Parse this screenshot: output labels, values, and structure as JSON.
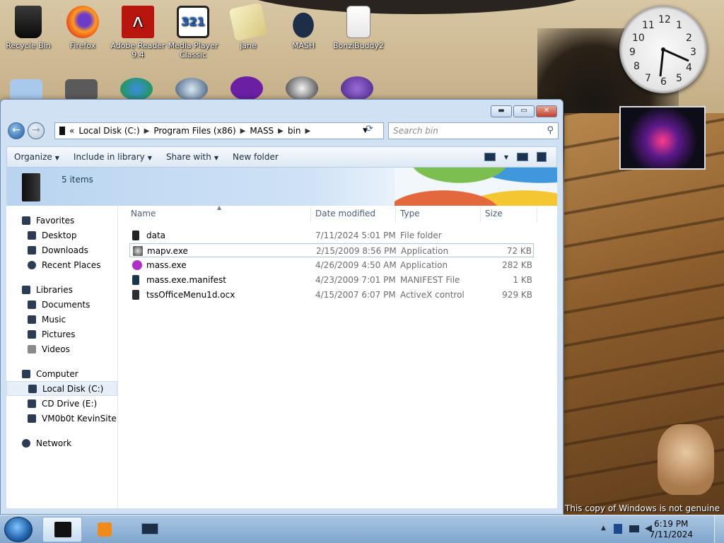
{
  "desktop": {
    "icons_row1": [
      {
        "label": "Recycle Bin",
        "icon": "recycle-bin-icon"
      },
      {
        "label": "Firefox",
        "icon": "firefox-icon"
      },
      {
        "label": "Adobe Reader 9.4",
        "icon": "adobe-reader-icon"
      },
      {
        "label": "Media Player Classic",
        "icon": "media-player-icon"
      },
      {
        "label": "jane",
        "icon": "jane-icon"
      },
      {
        "label": "MASH",
        "icon": "mash-icon"
      },
      {
        "label": "BonziBuddy2",
        "icon": "bonzibuddy-icon"
      }
    ],
    "genuine_text": "This copy of Windows is not genuine",
    "clock_numbers": [
      "12",
      "1",
      "2",
      "3",
      "4",
      "5",
      "6",
      "7",
      "8",
      "9",
      "10",
      "11"
    ]
  },
  "window": {
    "address": {
      "segments": [
        "Local Disk (C:)",
        "Program Files (x86)",
        "MASS",
        "bin"
      ],
      "overflow": "«"
    },
    "search_placeholder": "Search bin",
    "toolbar": {
      "organize": "Organize",
      "include": "Include in library",
      "share": "Share with",
      "new_folder": "New folder"
    },
    "banner": {
      "count": "5 items"
    },
    "nav": {
      "favorites": {
        "label": "Favorites",
        "items": [
          "Desktop",
          "Downloads",
          "Recent Places"
        ]
      },
      "libraries": {
        "label": "Libraries",
        "items": [
          "Documents",
          "Music",
          "Pictures",
          "Videos"
        ]
      },
      "computer": {
        "label": "Computer",
        "items": [
          "Local Disk (C:)",
          "CD Drive (E:)",
          "VM0b0t KevinSite"
        ]
      },
      "network": {
        "label": "Network"
      }
    },
    "columns": {
      "name": "Name",
      "date": "Date modified",
      "type": "Type",
      "size": "Size"
    },
    "files": [
      {
        "name": "data",
        "date": "7/11/2024 5:01 PM",
        "type": "File folder",
        "size": "",
        "color": "#222222"
      },
      {
        "name": "mapv.exe",
        "date": "2/15/2009 8:56 PM",
        "type": "Application",
        "size": "72 KB",
        "color": "#3a3a3a"
      },
      {
        "name": "mass.exe",
        "date": "4/26/2009 4:50 AM",
        "type": "Application",
        "size": "282 KB",
        "color": "#b02ec7"
      },
      {
        "name": "mass.exe.manifest",
        "date": "4/23/2009 7:01 PM",
        "type": "MANIFEST File",
        "size": "1 KB",
        "color": "#1c3350"
      },
      {
        "name": "tssOfficeMenu1d.ocx",
        "date": "4/15/2007 6:07 PM",
        "type": "ActiveX control",
        "size": "929 KB",
        "color": "#2f2f2f"
      }
    ]
  },
  "taskbar": {
    "time": "6:19 PM",
    "date": "7/11/2024"
  }
}
